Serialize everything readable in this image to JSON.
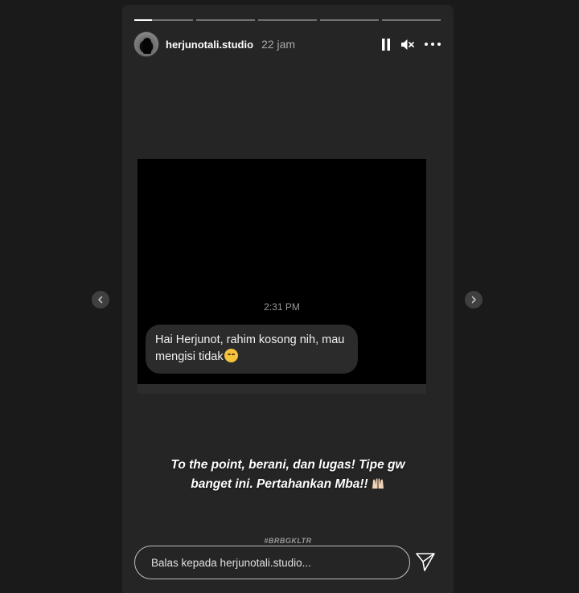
{
  "story": {
    "username": "herjunotali.studio",
    "time_ago": "22 jam",
    "progress": [
      0.3,
      0,
      0,
      0,
      0
    ],
    "timestamp": "2:31 PM",
    "message_text": "Hai Herjunot, rahim kosong nih, mau mengisi tidak",
    "message_emoji": "rolling-eyes-emoji",
    "caption_line1": "To the point, berani, dan lugas! Tipe gw",
    "caption_line2": "banget ini. Pertahankan Mba!!",
    "caption_emoji": "raised-hands-emoji",
    "hashtag": "#BRBGKLTR"
  },
  "reply": {
    "placeholder": "Balas kepada herjunotali.studio..."
  },
  "icons": {
    "pause": "pause-icon",
    "mute": "mute-icon",
    "more": "more-options-icon",
    "send": "send-icon",
    "prev": "chevron-left-icon",
    "next": "chevron-right-icon"
  },
  "colors": {
    "background": "#1a1a1a",
    "story_bg": "#252525",
    "text": "#ffffff",
    "muted": "#a8a8a8"
  }
}
